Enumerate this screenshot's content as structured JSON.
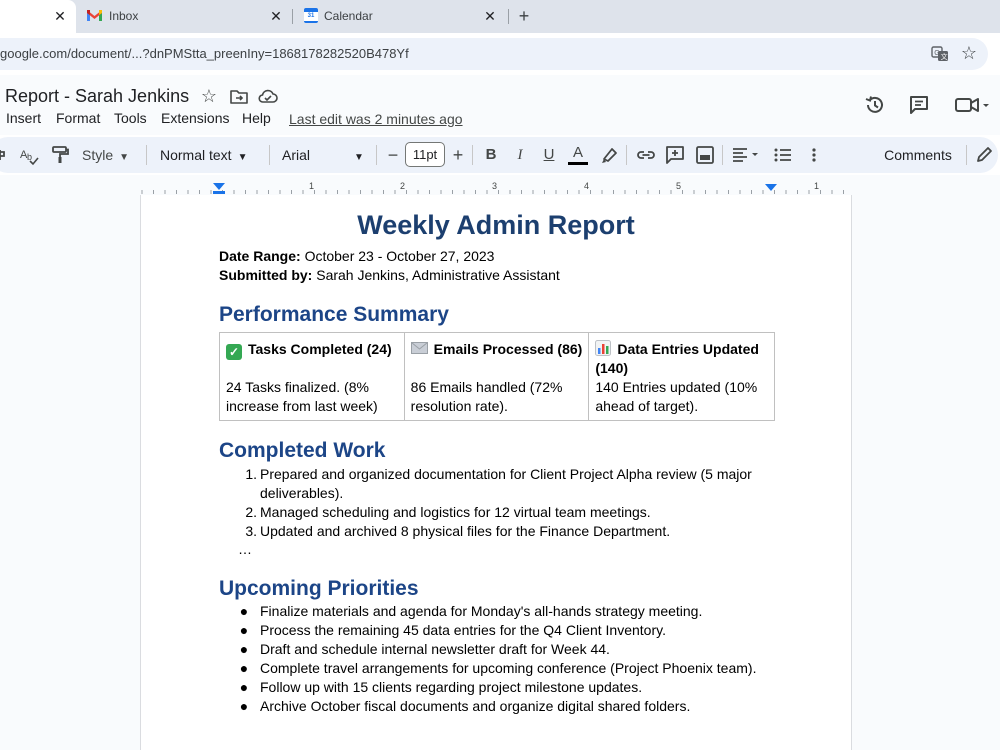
{
  "browser": {
    "tabs": [
      {
        "label": "",
        "active": true
      },
      {
        "label": "Inbox",
        "icon": "gmail-icon"
      },
      {
        "label": "Calendar",
        "icon": "calendar-icon"
      }
    ],
    "close_glyph": "✕",
    "new_tab_glyph": "+",
    "url": "google.com/document/...?dnPMStta_preenIny=1868178282520B478Yf",
    "calendar_icon_text": "31"
  },
  "docs": {
    "title": "Report - Sarah Jenkins",
    "menu": [
      "Insert",
      "Format",
      "Tools",
      "Extensions",
      "Help"
    ],
    "last_edit": "Last edit was 2 minutes ago"
  },
  "toolbar": {
    "style_label": "Style",
    "paragraph_style": "Normal text",
    "font": "Arial",
    "font_size": "11pt",
    "comments_label": "Comments",
    "decrease_glyph": "−",
    "increase_glyph": "+",
    "bold": "B",
    "italic": "I",
    "underline": "U",
    "text_color": "A"
  },
  "ruler": {
    "numbers": [
      "1",
      "1",
      "2",
      "3",
      "4",
      "5",
      "1"
    ]
  },
  "document": {
    "heading": "Weekly Admin Report",
    "date_range_label": "Date Range:",
    "date_range": "October 23 - October 27, 2023",
    "submitted_label": "Submitted by:",
    "submitted_by": "Sarah Jenkins, Administrative Assistant",
    "performance_heading": "Performance Summary",
    "summary": [
      {
        "title": "Tasks Completed (24)",
        "body": "24 Tasks finalized. (8% increase from last week)"
      },
      {
        "title": "Emails Processed (86)",
        "body": "86 Emails handled (72% resolution rate)."
      },
      {
        "title": "Data Entries Updated (140)",
        "body": "140 Entries updated (10% ahead of target)."
      }
    ],
    "completed_heading": "Completed Work",
    "completed": [
      {
        "num": "1.",
        "text": "Prepared and organized documentation for Client Project Alpha review (5 major deliverables)."
      },
      {
        "num": "2.",
        "text": "Managed scheduling and logistics for 12 virtual team meetings."
      },
      {
        "num": "3.",
        "text": "Updated and archived 8 physical files for the Finance Department."
      }
    ],
    "ellipsis": "…",
    "upcoming_heading": "Upcoming Priorities",
    "bullet": "●",
    "upcoming": [
      "Finalize materials and agenda for Monday's all-hands strategy meeting.",
      "Process the remaining 45 data entries for the Q4 Client Inventory.",
      "Draft and schedule internal newsletter draft for Week 44.",
      "Complete travel arrangements for upcoming conference (Project Phoenix team).",
      "Follow up with 15 clients regarding project milestone updates.",
      "Archive October fiscal documents and organize digital shared folders."
    ]
  },
  "colors": {
    "heading": "#1c3f6f",
    "subheading": "#1c4587",
    "tabstrip": "#dee3eb",
    "toolbar_bg": "#edf2fa"
  }
}
